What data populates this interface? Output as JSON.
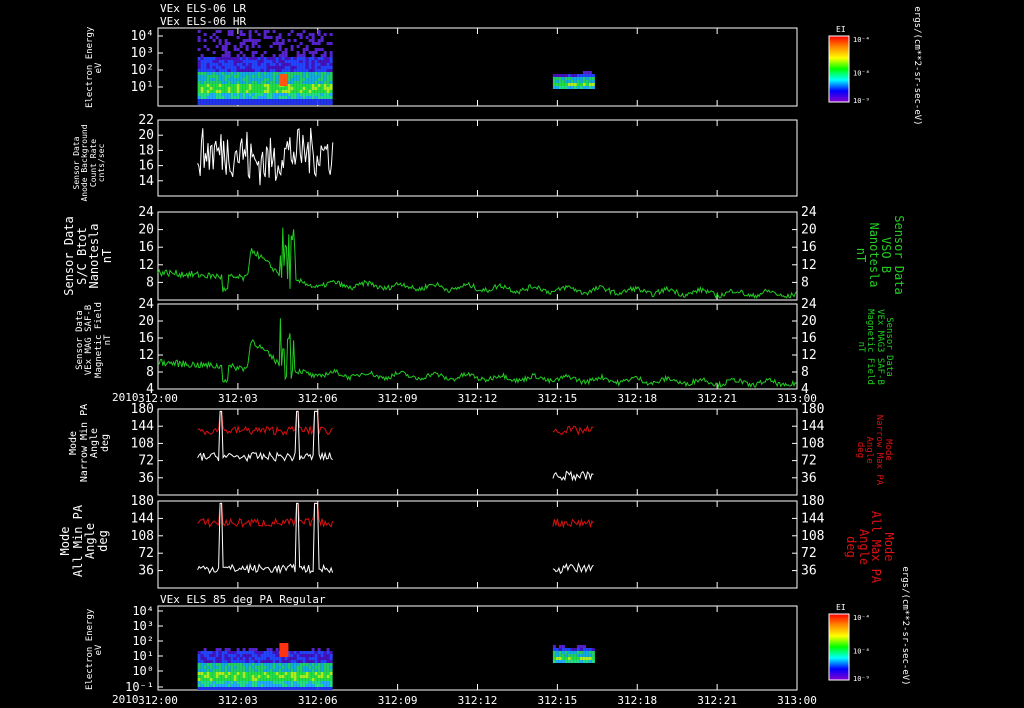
{
  "header": {
    "line1": "VEx ELS-06 LR",
    "line2": "VEx ELS-06 HR",
    "bottom_panel_title": "VEx ELS 85 deg PA Regular",
    "year_label": "2010"
  },
  "colorbar": {
    "title": "EI",
    "ticks": [
      "10⁻⁴",
      "10⁻⁸",
      "10⁻⁹"
    ],
    "unit": "ergs/(cm**2-sr-sec-eV)"
  },
  "chart_data": [
    {
      "type": "heatmap",
      "panel": "electron-energy-top",
      "ylabel": [
        "Electron Energy",
        "eV"
      ],
      "yscale": "log",
      "ytick_labels": [
        "10⁴",
        "10³",
        "10²",
        "10¹"
      ],
      "xlim": [
        "312:00",
        "313:00"
      ],
      "data_blocks": [
        {
          "x_start": "312:01",
          "x_end": "312:06",
          "y_range_eV": [
            1,
            10000
          ]
        },
        {
          "x_start": "312:15",
          "x_end": "312:16",
          "y_range_eV": [
            10,
            300
          ]
        }
      ]
    },
    {
      "type": "line",
      "panel": "anode-background",
      "ylabel": [
        "Sensor Data",
        "Anode Background",
        "Count Rate",
        "cnts/sec"
      ],
      "ylim": [
        12,
        22
      ],
      "ytick_labels": [
        "22",
        "20",
        "18",
        "16",
        "14"
      ],
      "series": [
        {
          "color": "#ffffff",
          "x_range": [
            "312:01",
            "312:06"
          ],
          "typical_range": [
            14,
            21
          ]
        }
      ]
    },
    {
      "type": "line",
      "panel": "btot",
      "ylabel": [
        "Sensor Data",
        "S/C Btot",
        "Nanotesla",
        "nT"
      ],
      "ylabel_right": [
        "Sensor Data",
        "VSO B",
        "Nanotesla",
        "nT"
      ],
      "ylim": [
        4,
        24
      ],
      "ytick_labels": [
        "24",
        "20",
        "16",
        "12",
        "8"
      ],
      "series": [
        {
          "color": "#22cc22",
          "baseline_nT": [
            5,
            10
          ],
          "peak_nT": 21,
          "peak_x": "312:04"
        }
      ]
    },
    {
      "type": "line",
      "panel": "saf-b",
      "ylabel": [
        "Sensor Data",
        "VEx MAG SAF-B",
        "Magnetic Field",
        "nT"
      ],
      "ylabel_right": [
        "Sensor Data",
        "VEx MAG3 SAF-B",
        "Magnetic Field",
        "nT"
      ],
      "ylim": [
        4,
        24
      ],
      "ytick_labels": [
        "24",
        "20",
        "16",
        "12",
        "8",
        "4"
      ],
      "series": [
        {
          "color": "#22cc22",
          "baseline_nT": [
            5,
            10
          ],
          "peak_nT": 21,
          "peak_x": "312:04"
        }
      ]
    },
    {
      "type": "line",
      "panel": "narrow-pa",
      "ylabel": [
        "Mode",
        "Narrow Min PA",
        "Angle",
        "deg"
      ],
      "ylabel_right": [
        "Mode",
        "Narrow Max PA",
        "Angle",
        "deg"
      ],
      "ylim": [
        0,
        180
      ],
      "ytick_labels": [
        "180",
        "144",
        "108",
        "72",
        "36"
      ],
      "series": [
        {
          "name_side": "right",
          "color": "#dd1111",
          "typical_deg": [
            120,
            150
          ]
        },
        {
          "name_side": "left",
          "color": "#ffffff",
          "typical_deg": [
            30,
            100
          ]
        }
      ]
    },
    {
      "type": "line",
      "panel": "all-pa",
      "ylabel": [
        "Mode",
        "All Min PA",
        "Angle",
        "deg"
      ],
      "ylabel_right": [
        "Mode",
        "All Max PA",
        "Angle",
        "deg"
      ],
      "ylim": [
        0,
        180
      ],
      "ytick_labels": [
        "180",
        "144",
        "108",
        "72",
        "36"
      ],
      "series": [
        {
          "name_side": "right",
          "color": "#dd1111",
          "typical_deg": [
            120,
            150
          ]
        },
        {
          "name_side": "left",
          "color": "#ffffff",
          "typical_deg": [
            20,
            60
          ]
        }
      ]
    },
    {
      "type": "heatmap",
      "panel": "electron-energy-bottom",
      "ylabel": [
        "Electron Energy",
        "eV"
      ],
      "yscale": "log",
      "ytick_labels": [
        "10⁴",
        "10³",
        "10²",
        "10¹",
        "10⁰",
        "10⁻¹"
      ],
      "data_blocks": [
        {
          "x_start": "312:01",
          "x_end": "312:06",
          "y_range_eV": [
            1,
            1000
          ]
        },
        {
          "x_start": "312:15",
          "x_end": "312:16",
          "y_range_eV": [
            10,
            300
          ]
        }
      ]
    }
  ],
  "x_axis": {
    "tick_labels": [
      "312:00",
      "312:03",
      "312:06",
      "312:09",
      "312:12",
      "312:15",
      "312:18",
      "312:21",
      "313:00"
    ]
  }
}
